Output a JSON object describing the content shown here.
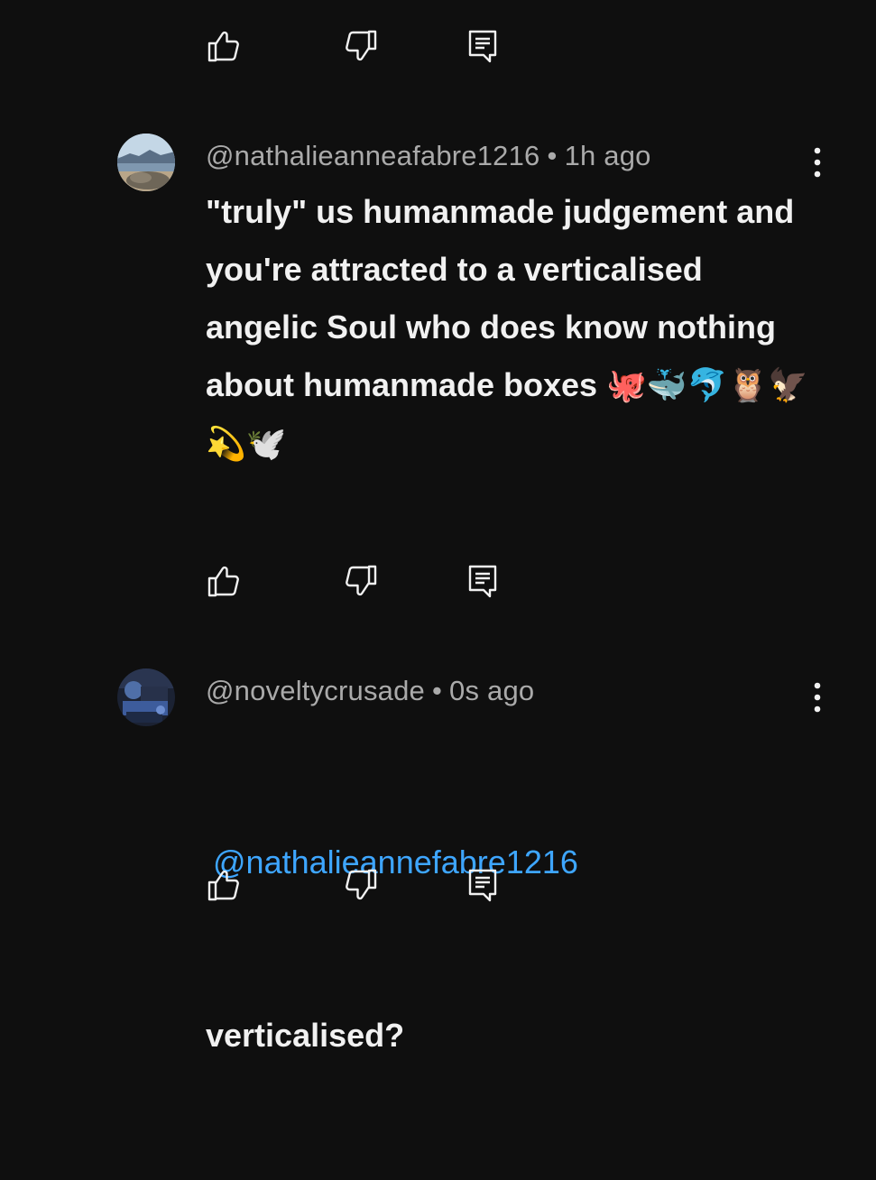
{
  "top_actions": {
    "like_icon": "thumb-up-icon",
    "dislike_icon": "thumb-down-icon",
    "reply_icon": "reply-comment-icon"
  },
  "comments": [
    {
      "author": "@nathalieanneafabre1216",
      "time": "1h ago",
      "separator": "•",
      "text": "\"truly\" us humanmade judgement and you're attracted to a verticalised angelic Soul who does know nothing about humanmade boxes ",
      "emojis": "🐙🐳🐬🦉🦅💫🕊️",
      "more_icon": "vertical-ellipsis-icon",
      "avatar_icon": "avatar-beach-photo"
    },
    {
      "author": "@noveltycrusade",
      "time": "0s ago",
      "separator": "•",
      "mention": "@nathalieannefabre1216",
      "text": "verticalised?",
      "more_icon": "vertical-ellipsis-icon",
      "avatar_icon": "avatar-night-photo"
    }
  ],
  "colors": {
    "background": "#0f0f0f",
    "text": "#f1f1f1",
    "meta": "#aaaaaa",
    "mention": "#3ea6ff"
  }
}
